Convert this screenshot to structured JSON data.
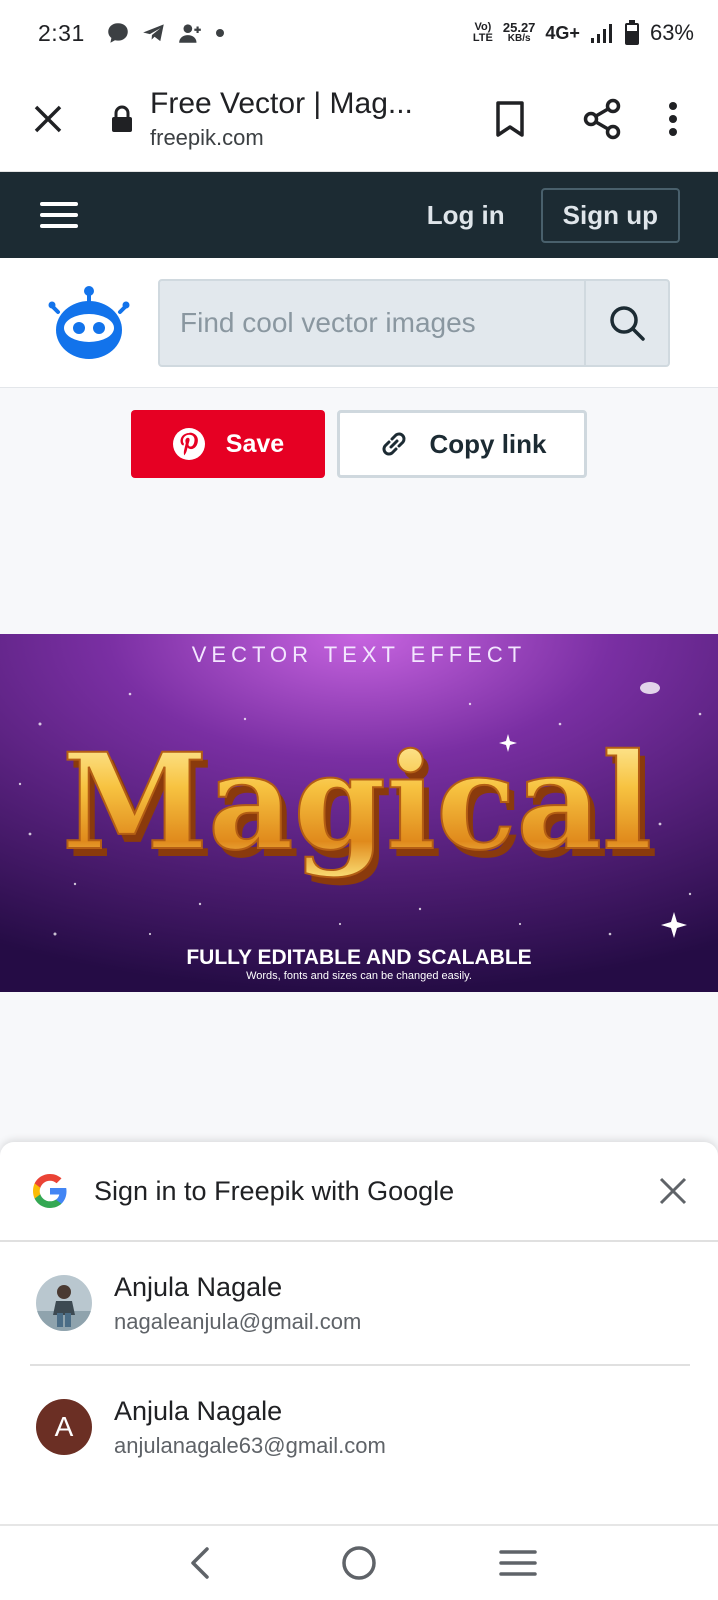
{
  "status_bar": {
    "time": "2:31",
    "volte_top": "Vo)",
    "volte_bottom": "LTE",
    "speed_value": "25.27",
    "speed_unit": "KB/s",
    "network": "4G+",
    "battery": "63%",
    "icons": [
      "message-icon",
      "telegram-icon",
      "person-add-icon",
      "dot-icon",
      "signal-icon",
      "battery-icon"
    ]
  },
  "browser": {
    "title": "Free Vector | Mag...",
    "url": "freepik.com",
    "icons": [
      "close-icon",
      "lock-icon",
      "bookmark-icon",
      "share-icon",
      "more-vert-icon"
    ]
  },
  "site_nav": {
    "login": "Log in",
    "signup": "Sign up"
  },
  "search": {
    "placeholder": "Find cool vector images"
  },
  "share": {
    "save_label": "Save",
    "copy_label": "Copy link"
  },
  "hero": {
    "tagline": "VECTOR TEXT EFFECT",
    "word": "Magical",
    "subtitle": "FULLY EDITABLE AND SCALABLE",
    "note": "Words, fonts and sizes can be changed easily.",
    "colors": {
      "bg_top": "#8a3fb0",
      "bg_bottom": "#2a0f4a",
      "gold": "#f7c341",
      "gold_dark": "#9a4a10"
    }
  },
  "google_sheet": {
    "title": "Sign in to Freepik with Google",
    "accounts": [
      {
        "name": "Anjula Nagale",
        "email": "nagaleanjula@gmail.com",
        "avatar": "photo"
      },
      {
        "name": "Anjula Nagale",
        "email": "anjulanagale63@gmail.com",
        "avatar": "letter",
        "letter": "A"
      }
    ]
  },
  "nav_bar": {
    "icons": [
      "back-icon",
      "home-icon",
      "recents-icon"
    ]
  }
}
